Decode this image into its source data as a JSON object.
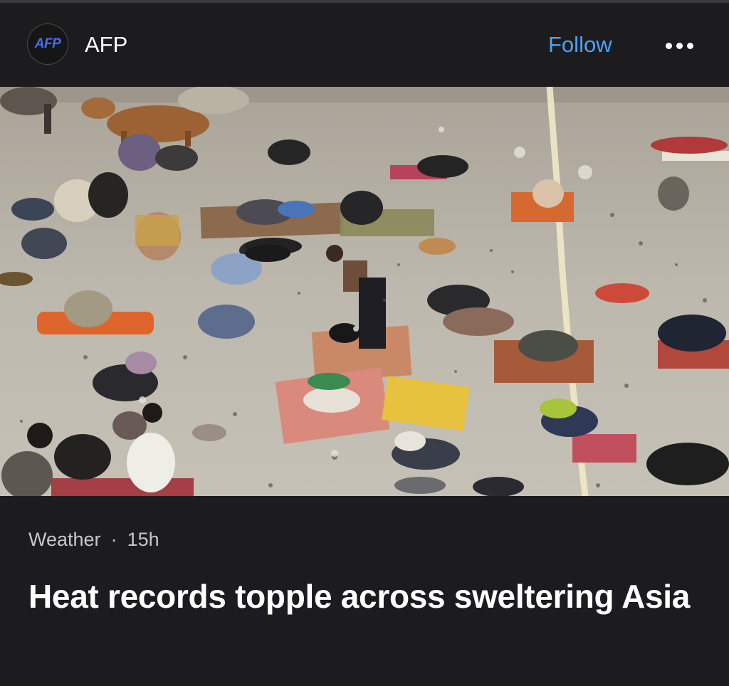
{
  "publisher": {
    "logo_text": "AFP",
    "name": "AFP"
  },
  "header": {
    "follow_label": "Follow",
    "more_icon": "more-horizontal-icon"
  },
  "image": {
    "alt": "People lying on mats on a dusty ground under a bridge with cattle in the background"
  },
  "article": {
    "category": "Weather",
    "separator": "·",
    "age": "15h",
    "headline": "Heat records topple across sweltering Asia"
  },
  "colors": {
    "background": "#1c1c1e",
    "accent_follow": "#4ea3f5",
    "logo_blue": "#4a6cf0",
    "meta_text": "#c7c7cc"
  }
}
